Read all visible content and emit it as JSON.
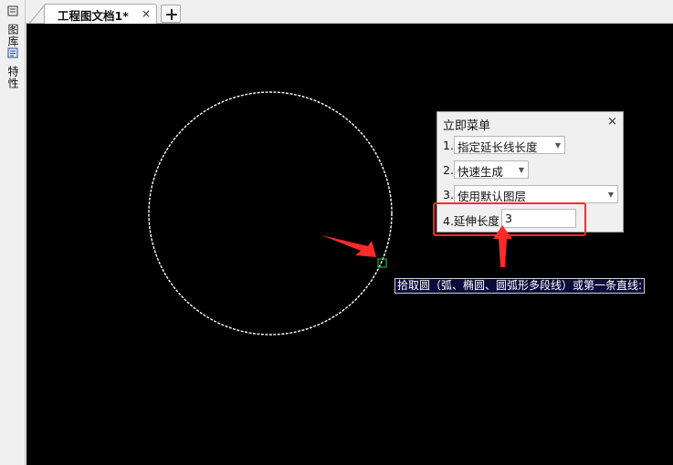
{
  "tabs": {
    "document_title": "工程图文档1*",
    "close_glyph": "×",
    "new_tab_icon": "plus-icon"
  },
  "left_panel": {
    "items": [
      {
        "label": "图库",
        "icon": "library-icon"
      },
      {
        "label": "特性",
        "icon": "properties-icon"
      }
    ]
  },
  "immediate_menu": {
    "title": "立即菜单",
    "close_glyph": "×",
    "rows": [
      {
        "number": "1.",
        "value": "指定延长线长度"
      },
      {
        "number": "2.",
        "value": "快速生成"
      },
      {
        "number": "3.",
        "value": "使用默认图层"
      }
    ],
    "length_label": "4.延伸长度",
    "length_value": "3"
  },
  "prompt": {
    "text": "拾取圆（弧、椭圆、圆弧形多段线）或第一条直线:"
  },
  "colors": {
    "canvas": "#000000",
    "circle": "#ffffff",
    "annotation": "#ff2a2a",
    "pick_box": "#2ecc40",
    "prompt_bg": "#0a0a3a"
  }
}
